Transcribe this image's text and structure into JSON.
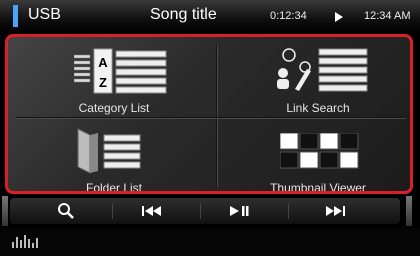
{
  "status": {
    "source": "USB",
    "song_title": "Song title",
    "elapsed": "0:12:34",
    "clock": "12:34 AM"
  },
  "menu": {
    "category_list": "Category List",
    "link_search": "Link Search",
    "folder_list": "Folder List",
    "thumbnail_viewer": "Thumbnail Viewer",
    "az_top": "A",
    "az_bottom": "Z"
  },
  "controls": [
    {
      "name": "search",
      "icon": "search-icon"
    },
    {
      "name": "previous",
      "icon": "previous-track-icon"
    },
    {
      "name": "play-pause",
      "icon": "play-pause-icon"
    },
    {
      "name": "next",
      "icon": "next-track-icon"
    }
  ],
  "colors": {
    "accent_border": "#d8202a",
    "usb_indicator": "#4aa3ff"
  },
  "bottom": {
    "icon": "equalizer-icon"
  }
}
